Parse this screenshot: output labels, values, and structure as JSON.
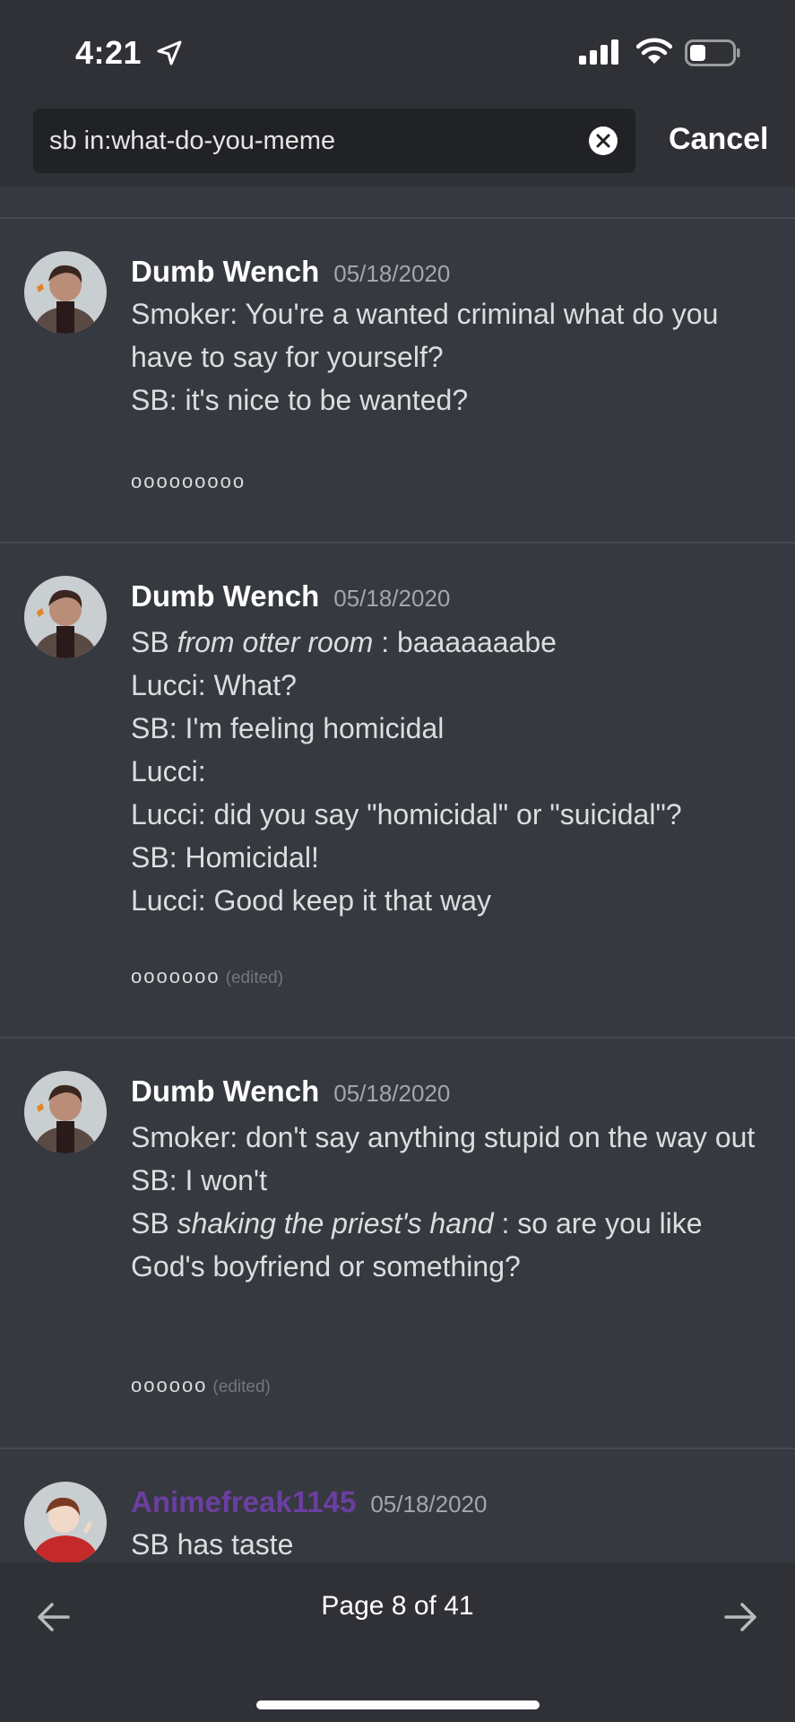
{
  "status_bar": {
    "time": "4:21"
  },
  "search": {
    "query": "sb in:what-do-you-meme",
    "cancel_label": "Cancel"
  },
  "messages": [
    {
      "author": "Dumb Wench",
      "date": "05/18/2020",
      "lines": [
        "Smoker: You're a wanted criminal what do you have to say for yourself?",
        "SB: it's nice to be wanted?"
      ],
      "dots": "ooooooooo",
      "edited": ""
    },
    {
      "author": "Dumb Wench",
      "date": "05/18/2020",
      "line1_prefix": "SB ",
      "line1_italic": "from otter room",
      "line1_suffix": " : baaaaaaabe",
      "lines": [
        "Lucci: What?",
        "SB: I'm feeling homicidal",
        "Lucci:",
        "Lucci: did you say \"homicidal\" or \"suicidal\"?",
        "SB: Homicidal!",
        "Lucci: Good keep it that way"
      ],
      "dots": "ooooooo",
      "edited": "(edited)"
    },
    {
      "author": "Dumb Wench",
      "date": "05/18/2020",
      "lines": [
        "Smoker: don't say anything stupid on the way out",
        "SB: I won't"
      ],
      "line_last_prefix": "SB ",
      "line_last_italic": "shaking the priest's hand",
      "line_last_suffix": " : so are you like God's boyfriend or something?",
      "dots": "oooooo",
      "edited": "(edited)"
    },
    {
      "author": "Animefreak1145",
      "date": "05/18/2020",
      "lines": [
        "SB has taste"
      ]
    }
  ],
  "footer": {
    "page_label": "Page 8 of 41"
  },
  "colors": {
    "background": "#36393f",
    "bar": "#2f3136",
    "purple_author": "#6b3fa0"
  }
}
